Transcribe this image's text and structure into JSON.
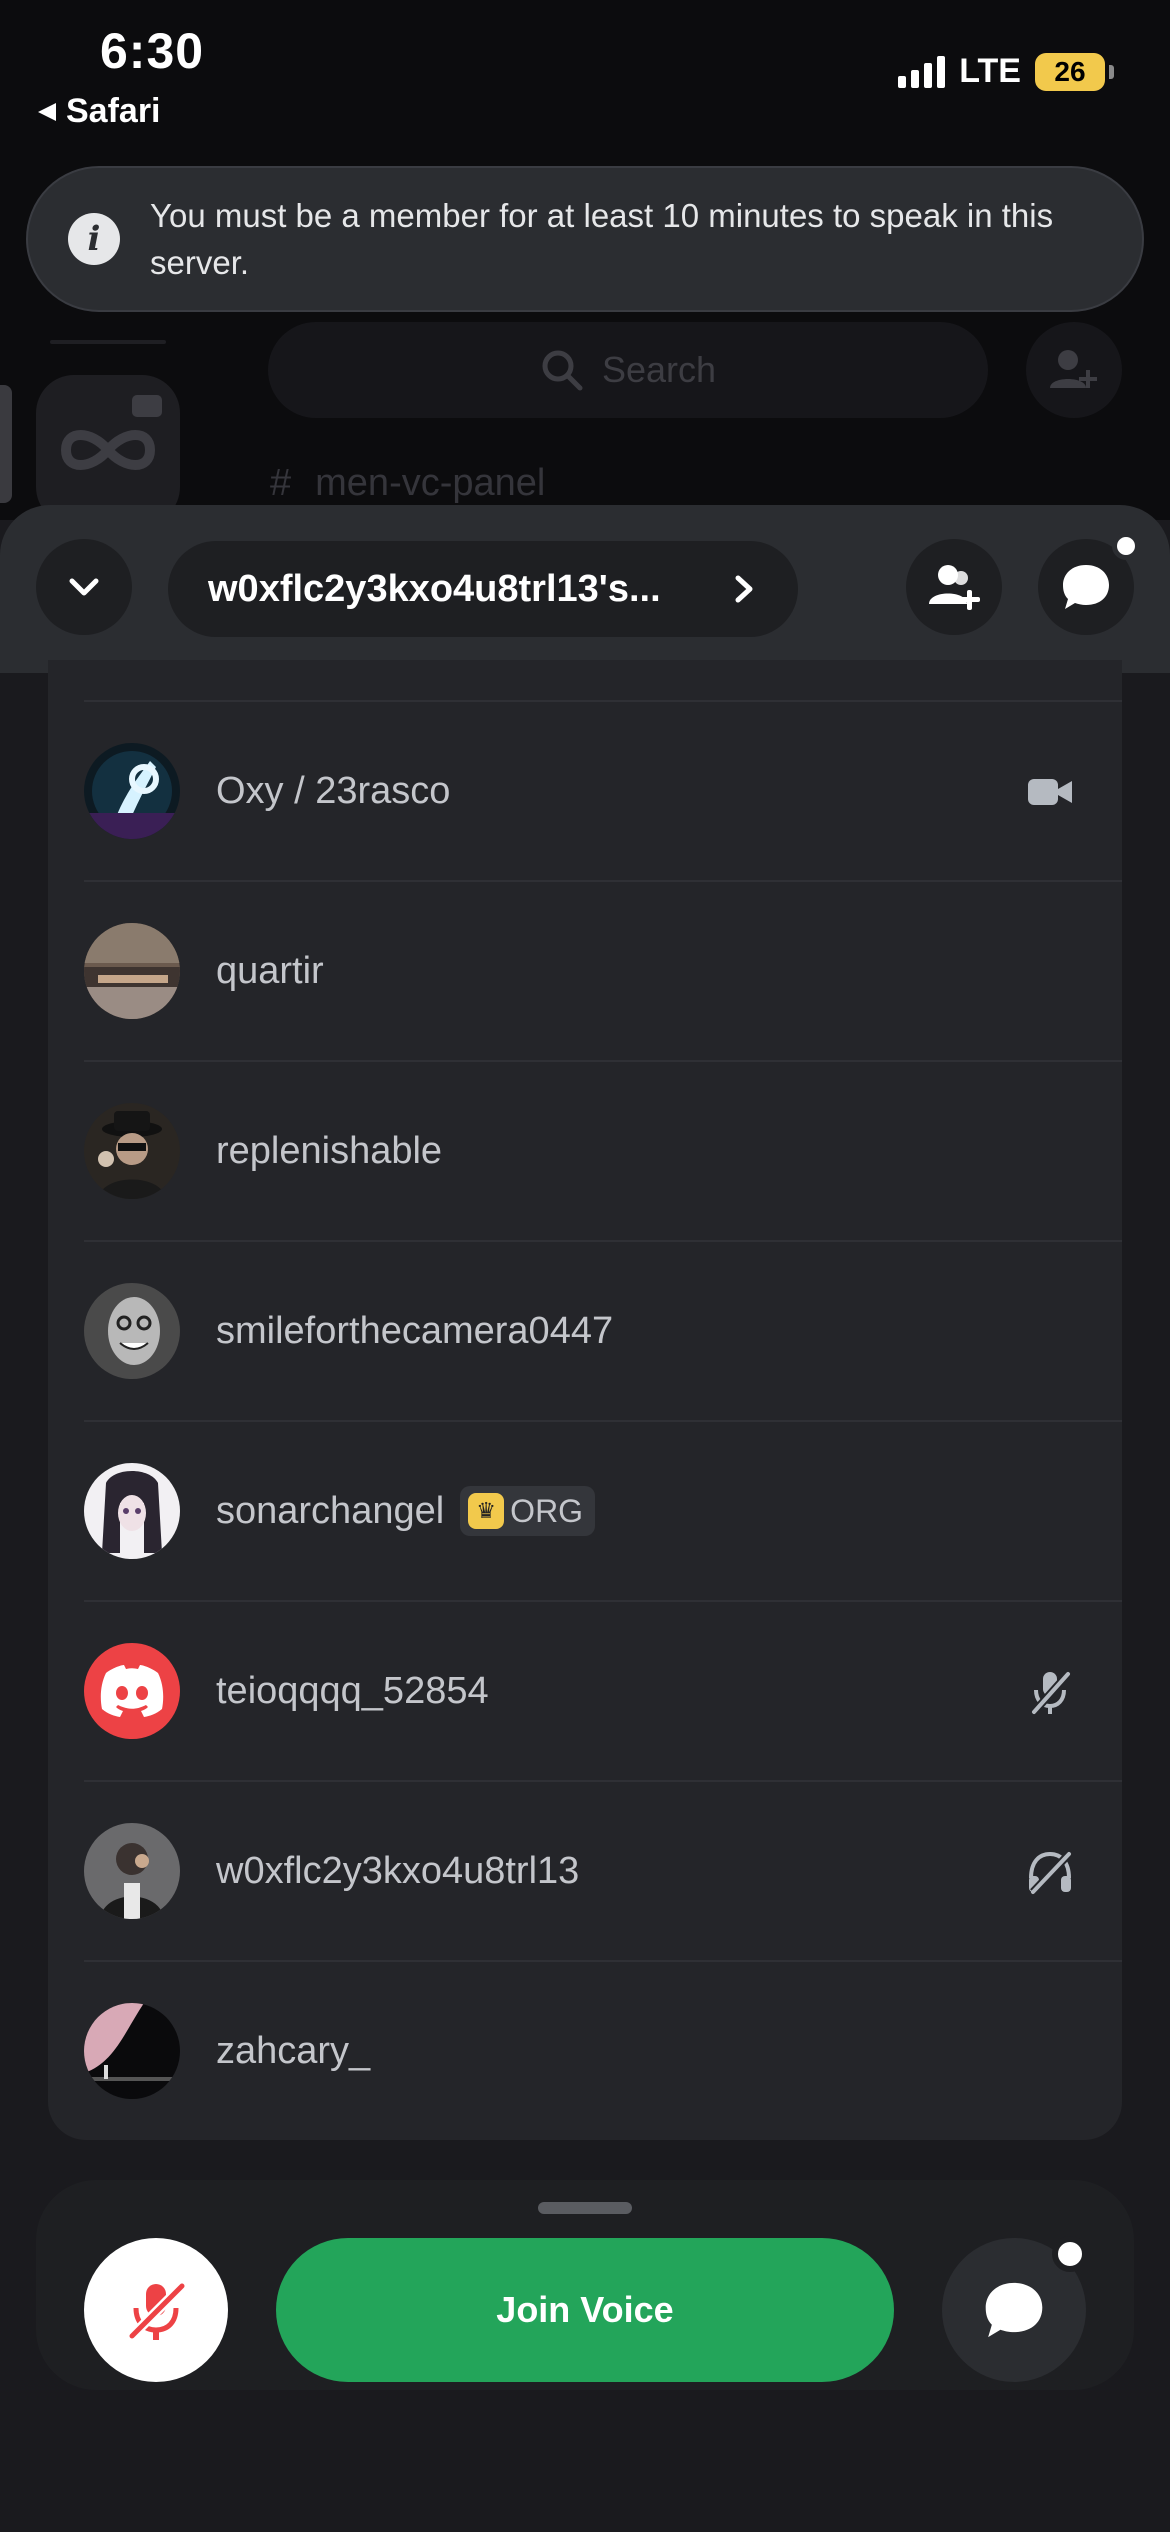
{
  "status_bar": {
    "time": "6:30",
    "back_app": "Safari",
    "network": "LTE",
    "battery": "26"
  },
  "background": {
    "search_placeholder": "Search",
    "channel_name": "men-vc-panel"
  },
  "toast": {
    "icon": "info-icon",
    "message": "You must be a member for at least 10 minutes to speak in this server."
  },
  "voice_panel": {
    "title": "w0xflc2y3kxo4u8trl13's...",
    "icons": {
      "collapse": "chevron-down-icon",
      "title_arrow": "chevron-right-icon",
      "invite": "add-user-icon",
      "chat": "chat-bubble-icon"
    }
  },
  "members": [
    {
      "name": "Oxy / 23rasco",
      "status_icon": "video-camera-icon"
    },
    {
      "name": "quartir",
      "status_icon": ""
    },
    {
      "name": "replenishable",
      "status_icon": ""
    },
    {
      "name": "smileforthecamera0447",
      "status_icon": ""
    },
    {
      "name": "sonarchangel",
      "status_icon": "",
      "badge": "ORG"
    },
    {
      "name": "teioqqqq_52854",
      "status_icon": "muted-mic-icon"
    },
    {
      "name": "w0xflc2y3kxo4u8trl13",
      "status_icon": "deafened-icon"
    },
    {
      "name": "zahcary_",
      "status_icon": ""
    }
  ],
  "bottom_bar": {
    "join_label": "Join Voice",
    "mic_icon": "muted-mic-icon",
    "chat_icon": "chat-bubble-icon"
  },
  "colors": {
    "join_green": "#23a55a",
    "muted_red": "#ed4245",
    "discord_blurple_red": "#ed4245",
    "battery_yellow": "#f2c94c"
  }
}
